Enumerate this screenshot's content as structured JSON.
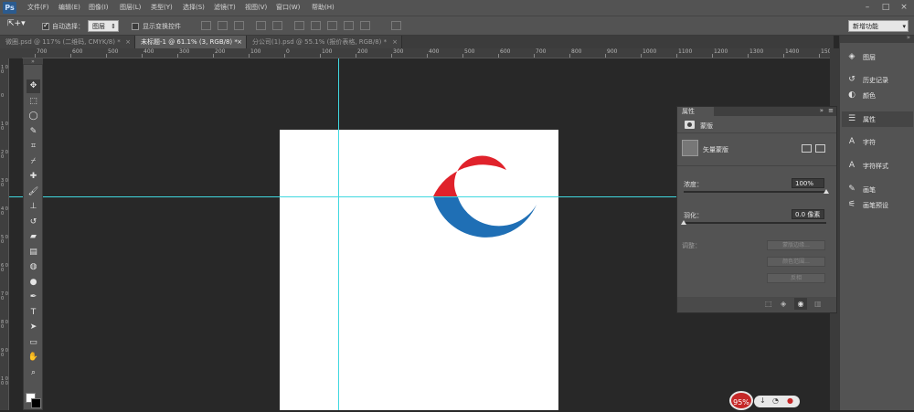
{
  "app": {
    "logo": "Ps"
  },
  "menu": [
    "文件(F)",
    "编辑(E)",
    "图像(I)",
    "图层(L)",
    "类型(Y)",
    "选择(S)",
    "滤镜(T)",
    "视图(V)",
    "窗口(W)",
    "帮助(H)"
  ],
  "window_controls": {
    "minimize": "–",
    "maximize": "□",
    "close": "×"
  },
  "options": {
    "auto_select_label": "自动选择：",
    "auto_select_value": "图层",
    "show_transform_label": "显示变换控件",
    "workspace": "新增功能"
  },
  "tabs": [
    {
      "label": "微圈.psd @ 117% (二维码, CMYK/8) *",
      "close": "×"
    },
    {
      "label": "未标题-1 @ 61.1% (3, RGB/8) *",
      "close": "×"
    },
    {
      "label": "分公司(1).psd @ 55.1% (报价表格, RGB/8) *",
      "close": "×"
    }
  ],
  "ruler_top": [
    "700",
    "600",
    "500",
    "400",
    "300",
    "200",
    "100",
    "0",
    "100",
    "200",
    "300",
    "400",
    "500",
    "600",
    "700",
    "800",
    "900",
    "1000",
    "1100",
    "1200",
    "1300",
    "1400",
    "1500"
  ],
  "ruler_left": [
    "1 0 0",
    "0",
    "1 0 0",
    "2 0 0",
    "3 0 0",
    "4 0 0",
    "5 0 0",
    "6 0 0",
    "7 0 0",
    "8 0 0",
    "9 0 0",
    "1 0 0 0"
  ],
  "tools": [
    {
      "name": "move-tool",
      "glyph": "✥"
    },
    {
      "name": "marquee-tool",
      "glyph": "⬚"
    },
    {
      "name": "lasso-tool",
      "glyph": "◯"
    },
    {
      "name": "quick-select-tool",
      "glyph": "✎"
    },
    {
      "name": "crop-tool",
      "glyph": "⌗"
    },
    {
      "name": "eyedropper-tool",
      "glyph": "⌿"
    },
    {
      "name": "healing-tool",
      "glyph": "✚"
    },
    {
      "name": "brush-tool",
      "glyph": "🖌"
    },
    {
      "name": "stamp-tool",
      "glyph": "⊥"
    },
    {
      "name": "history-brush-tool",
      "glyph": "↺"
    },
    {
      "name": "eraser-tool",
      "glyph": "▰"
    },
    {
      "name": "gradient-tool",
      "glyph": "▤"
    },
    {
      "name": "blur-tool",
      "glyph": "◍"
    },
    {
      "name": "dodge-tool",
      "glyph": "●"
    },
    {
      "name": "pen-tool",
      "glyph": "✒"
    },
    {
      "name": "type-tool",
      "glyph": "T"
    },
    {
      "name": "path-select-tool",
      "glyph": "➤"
    },
    {
      "name": "shape-tool",
      "glyph": "▭"
    },
    {
      "name": "hand-tool",
      "glyph": "✋"
    },
    {
      "name": "zoom-tool",
      "glyph": "⌕"
    }
  ],
  "properties": {
    "tab": "属性",
    "header": "蒙版",
    "mask_type": "矢量蒙版",
    "density_label": "浓度：",
    "density_value": "100%",
    "density": 1.0,
    "feather_label": "羽化：",
    "feather_value": "0.0 像素",
    "feather": 0.0,
    "refine_label": "调整：",
    "btn_mask_edge": "蒙版边缘...",
    "btn_color_range": "颜色范围...",
    "btn_invert": "反相"
  },
  "dock": [
    {
      "icon": "layers-icon",
      "glyph": "◈",
      "label": "图层"
    },
    {
      "icon": "history-icon",
      "glyph": "↺",
      "label": "历史记录"
    },
    {
      "icon": "color-icon",
      "glyph": "◐",
      "label": "颜色"
    },
    {
      "icon": "properties-icon",
      "glyph": "☰",
      "label": "属性",
      "active": true
    },
    {
      "icon": "character-icon",
      "glyph": "A",
      "label": "字符"
    },
    {
      "icon": "character-style-icon",
      "glyph": "A",
      "label": "字符样式"
    },
    {
      "icon": "brush-icon",
      "glyph": "✎",
      "label": "画笔"
    },
    {
      "icon": "brush-preset-icon",
      "glyph": "⚟",
      "label": "画笔预设"
    }
  ],
  "widget": {
    "percent": "95%"
  },
  "colors": {
    "red": "#e0222b",
    "blue": "#1f6fb5",
    "guide": "#40d8e0"
  }
}
